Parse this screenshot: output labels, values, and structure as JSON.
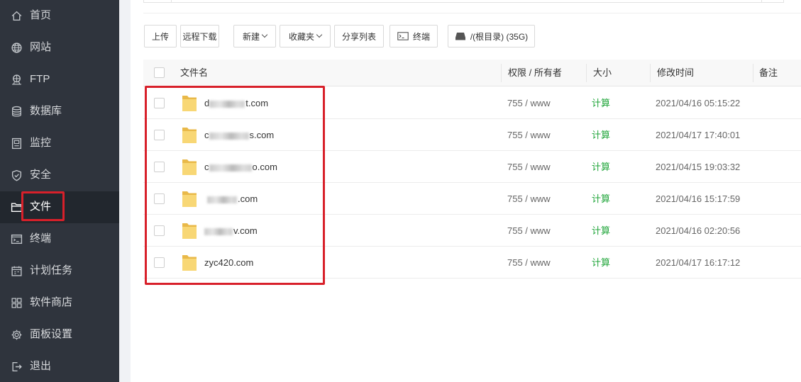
{
  "sidebar": {
    "items": [
      {
        "label": "首页",
        "icon": "home-icon"
      },
      {
        "label": "网站",
        "icon": "globe-icon"
      },
      {
        "label": "FTP",
        "icon": "ftp-icon"
      },
      {
        "label": "数据库",
        "icon": "database-icon"
      },
      {
        "label": "监控",
        "icon": "monitor-icon"
      },
      {
        "label": "安全",
        "icon": "shield-icon"
      },
      {
        "label": "文件",
        "icon": "folder-icon",
        "active": true
      },
      {
        "label": "终端",
        "icon": "terminal-icon"
      },
      {
        "label": "计划任务",
        "icon": "calendar-icon"
      },
      {
        "label": "软件商店",
        "icon": "apps-icon"
      },
      {
        "label": "面板设置",
        "icon": "gear-icon"
      },
      {
        "label": "退出",
        "icon": "logout-icon"
      }
    ]
  },
  "toolbar": {
    "upload": "上传",
    "remote_download": "远程下载",
    "new": "新建",
    "favorites": "收藏夹",
    "share_list": "分享列表",
    "terminal": "终端",
    "disk": "/(根目录) (35G)"
  },
  "table": {
    "headers": {
      "name": "文件名",
      "perm": "权限 / 所有者",
      "size": "大小",
      "mtime": "修改时间",
      "note": "备注"
    },
    "rows": [
      {
        "name_prefix": "d",
        "name_suffix": "t.com",
        "perm": "755 / www",
        "size": "计算",
        "mtime": "2021/04/16 05:15:22"
      },
      {
        "name_prefix": "c",
        "name_suffix": "s.com",
        "perm": "755 / www",
        "size": "计算",
        "mtime": "2021/04/17 17:40:01"
      },
      {
        "name_prefix": "c",
        "name_suffix": "o.com",
        "perm": "755 / www",
        "size": "计算",
        "mtime": "2021/04/15 19:03:32"
      },
      {
        "name_prefix": "",
        "name_suffix": ".com",
        "perm": "755 / www",
        "size": "计算",
        "mtime": "2021/04/16 15:17:59"
      },
      {
        "name_prefix": "",
        "name_suffix": "v.com",
        "perm": "755 / www",
        "size": "计算",
        "mtime": "2021/04/16 02:20:56"
      },
      {
        "name_prefix": "",
        "name_suffix": "zyc420.com",
        "perm": "755 / www",
        "size": "计算",
        "mtime": "2021/04/17 16:17:12"
      }
    ]
  },
  "colors": {
    "sidebar_bg": "#2f343d",
    "accent_green": "#20a53a",
    "highlight_red": "#d8202a",
    "folder_yellow": "#f8d775"
  }
}
